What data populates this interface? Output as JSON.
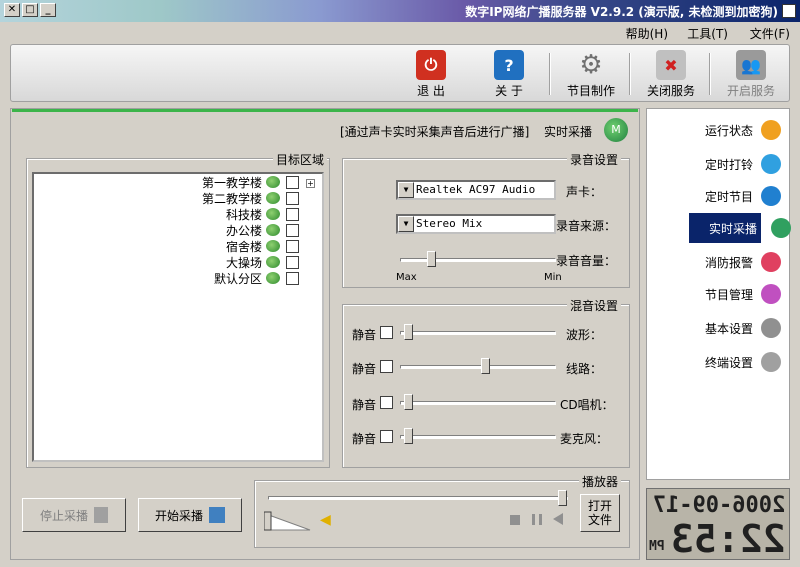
{
  "window": {
    "title": "数字IP网络广播服务器 V2.9.2 (演示版, 未检测到加密狗)",
    "buttons": [
      "✕",
      "□",
      "_"
    ]
  },
  "menu": [
    "文件(F)",
    "工具(T)",
    "帮助(H)"
  ],
  "toolbar": [
    {
      "label": "开启服务",
      "icon": "people-icon",
      "color": "#888888"
    },
    {
      "label": "关闭服务",
      "icon": "stop-server-icon",
      "color": "#c03030"
    },
    {
      "label": "节目制作",
      "icon": "gear-icon",
      "color": "#a0a0a0"
    },
    {
      "label": "关 于",
      "icon": "book-icon",
      "color": "#2070c0"
    },
    {
      "label": "退 出",
      "icon": "power-icon",
      "color": "#d03020"
    }
  ],
  "header": {
    "title": "实时采播",
    "hint": "[通过声卡实时采集声音后进行广播]"
  },
  "target": {
    "label": "目标区域",
    "nodes": [
      "第一教学楼",
      "第二教学楼",
      "科技楼",
      "办公楼",
      "宿舍楼",
      "大操场",
      "默认分区"
    ],
    "expander": "+"
  },
  "record": {
    "label": "录音设置",
    "card_label": "声卡：",
    "card_value": "Realtek AC97 Audio",
    "source_label": "录音来源：",
    "source_value": "Stereo Mix",
    "volume_label": "录音音量：",
    "volume_value": 0.82,
    "min_label": "Min",
    "max_label": "Max"
  },
  "mixer": {
    "label": "混音设置",
    "mute_label": "静音",
    "rows": [
      {
        "label": "波形：",
        "value": 0.97
      },
      {
        "label": "线路：",
        "value": 0.45
      },
      {
        "label": "CD唱机：",
        "value": 0.97
      },
      {
        "label": "麦克风：",
        "value": 0.97
      }
    ]
  },
  "player": {
    "label": "播放器",
    "open_label": "打开\n文件",
    "progress": 0.0,
    "volume": 0.85
  },
  "buttons": {
    "start": "开始采播",
    "stop": "停止采播"
  },
  "nav": [
    {
      "label": "运行状态",
      "color": "#f0a020"
    },
    {
      "label": "定时打铃",
      "color": "#30a0e0"
    },
    {
      "label": "定时节目",
      "color": "#2080d0"
    },
    {
      "label": "实时采播",
      "color": "#30a060",
      "selected": true
    },
    {
      "label": "消防报警",
      "color": "#e04060"
    },
    {
      "label": "节目管理",
      "color": "#c050c0"
    },
    {
      "label": "基本设置",
      "color": "#909090"
    },
    {
      "label": "终端设置",
      "color": "#a0a0a0"
    }
  ],
  "clock": {
    "date": "2006-09-17",
    "time": "22:53",
    "ampm": "PM"
  }
}
